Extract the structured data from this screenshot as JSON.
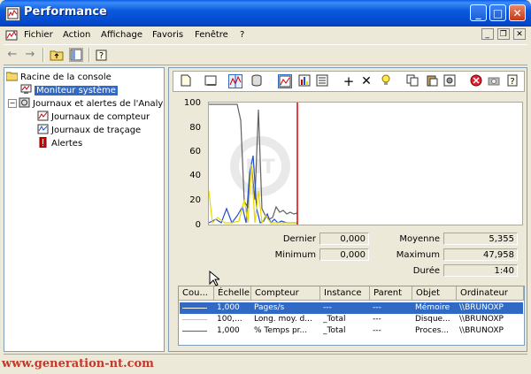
{
  "window": {
    "title": "Performance"
  },
  "title_buttons": {
    "minimize": "_",
    "maximize": "□",
    "close": "✕"
  },
  "menu": {
    "items": [
      "Fichier",
      "Action",
      "Affichage",
      "Favoris",
      "Fenêtre",
      "?"
    ]
  },
  "mdi_buttons": {
    "minimize": "_",
    "restore": "❐",
    "close": "✕"
  },
  "tree": {
    "items": [
      {
        "label": "Racine de la console",
        "icon": "folder-icon"
      },
      {
        "label": "Moniteur système",
        "icon": "monitor-icon",
        "selected": true
      },
      {
        "label": "Journaux et alertes de l'Analyseur",
        "icon": "logs-icon"
      },
      {
        "label": "Journaux de compteur",
        "icon": "counter-log-icon"
      },
      {
        "label": "Journaux de traçage",
        "icon": "trace-log-icon"
      },
      {
        "label": "Alertes",
        "icon": "alert-icon"
      }
    ]
  },
  "graph": {
    "yticks": [
      "100",
      "80",
      "60",
      "40",
      "20",
      "0"
    ],
    "ylim": [
      0,
      100
    ]
  },
  "stats": {
    "dernier_label": "Dernier",
    "dernier": "0,000",
    "moyenne_label": "Moyenne",
    "moyenne": "5,355",
    "minimum_label": "Minimum",
    "minimum": "0,000",
    "maximum_label": "Maximum",
    "maximum": "47,958",
    "duree_label": "Durée",
    "duree": "1:40"
  },
  "counters": {
    "columns": [
      "Cou...",
      "Échelle",
      "Compteur",
      "Instance",
      "Parent",
      "Objet",
      "Ordinateur"
    ],
    "rows": [
      {
        "color": "#1f4fd8",
        "scale": "1,000",
        "counter": "Pages/s",
        "instance": "---",
        "parent": "---",
        "object": "Mémoire",
        "computer": "\\\\BRUNOXP",
        "selected": true
      },
      {
        "color": "#e8d800",
        "scale": "100,...",
        "counter": "Long. moy. d...",
        "instance": "_Total",
        "parent": "---",
        "object": "Disque...",
        "computer": "\\\\BRUNOXP",
        "selected": false
      },
      {
        "color": "#606060",
        "scale": "1,000",
        "counter": "% Temps pr...",
        "instance": "_Total",
        "parent": "---",
        "object": "Proces...",
        "computer": "\\\\BRUNOXP",
        "selected": false
      }
    ]
  },
  "watermark": "www.generation-nt.com"
}
